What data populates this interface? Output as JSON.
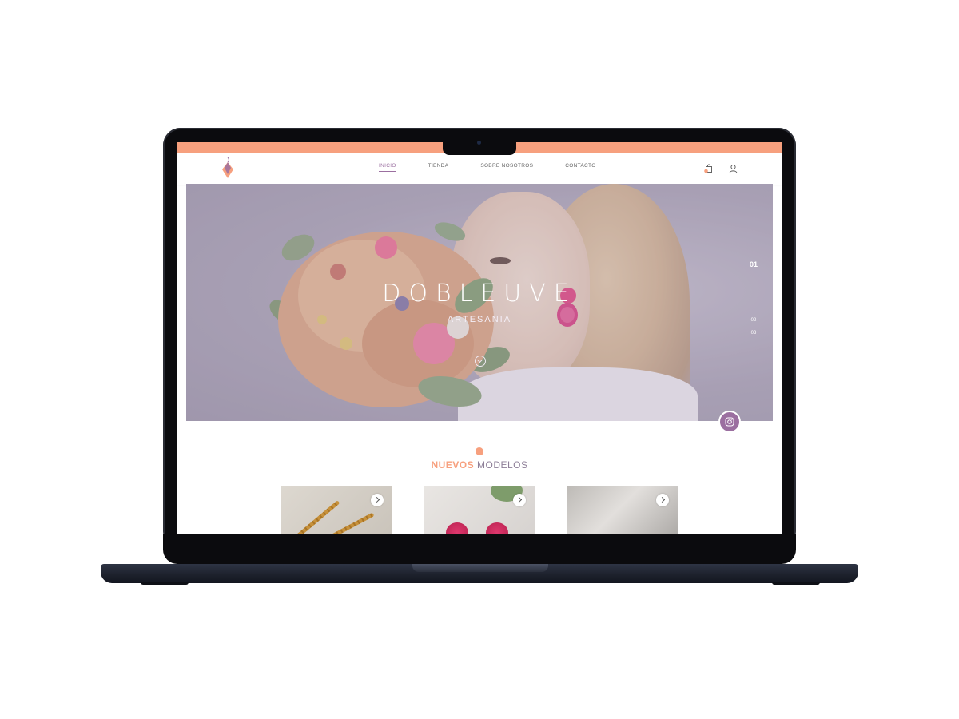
{
  "brand": {
    "accent_color": "#f7a07e",
    "secondary_color": "#9b6fa0"
  },
  "header": {
    "nav": [
      {
        "label": "INICIO",
        "active": true
      },
      {
        "label": "TIENDA",
        "active": false
      },
      {
        "label": "SOBRE NOSOTROS",
        "active": false
      },
      {
        "label": "CONTACTO",
        "active": false
      }
    ],
    "icons": {
      "cart": "shopping-bag-icon",
      "user": "user-icon",
      "logo": "diamond-earring-logo"
    }
  },
  "hero": {
    "title": "DOBLEUVE",
    "subtitle": "ARTESANIA",
    "slides": [
      "01",
      "02",
      "03"
    ],
    "current_slide": "01",
    "icons": {
      "scroll": "chevron-down-icon",
      "instagram": "instagram-icon"
    }
  },
  "new_models": {
    "title_accent": "NUEVOS",
    "title_rest": "MODELOS",
    "products": [
      {
        "icon": "chevron-right-icon"
      },
      {
        "icon": "chevron-right-icon"
      },
      {
        "icon": "chevron-right-icon"
      }
    ]
  }
}
